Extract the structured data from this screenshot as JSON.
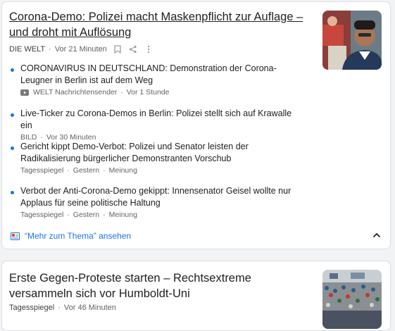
{
  "cluster1": {
    "headline": "Corona-Demo: Polizei macht Maskenpflicht zur Auflage – und droht mit Auflösung",
    "source": "DIE WELT",
    "time": "Vor 21 Minuten",
    "stories": [
      {
        "title": "CORONAVIRUS IN DEUTSCHLAND: Demonstration der Corona-Leugner in Berlin ist auf dem Weg",
        "source": "WELT Nachrichtensender",
        "time": "Vor 1 Stunde",
        "extra": "",
        "source_icon": "youtube-icon"
      },
      {
        "title": "Live-Ticker zu Corona-Demos in Berlin: Polizei stellt sich auf Krawalle ein",
        "source": "BILD",
        "time": "Vor 30 Minuten",
        "extra": ""
      },
      {
        "title": "Gericht kippt Demo-Verbot: Polizei und Senator leisten der Radikalisierung bürgerlicher Demonstranten Vorschub",
        "source": "Tagesspiegel",
        "time": "Gestern",
        "extra": "Meinung"
      },
      {
        "title": "Verbot der Anti-Corona-Demo gekippt: Innensenator Geisel wollte nur Applaus für seine politische Haltung",
        "source": "Tagesspiegel",
        "time": "Gestern",
        "extra": "Meinung"
      }
    ],
    "more_label": "“Mehr zum Thema” ansehen"
  },
  "cluster2": {
    "headline": "Erste Gegen-Proteste starten – Rechtsextreme versammeln sich vor Humboldt-Uni",
    "source": "Tagesspiegel",
    "time": "Vor 46 Minuten"
  },
  "sep": "·",
  "colors": {
    "link": "#1a73e8",
    "meta": "#5f6368",
    "text": "#202124",
    "border": "#dadce0"
  }
}
